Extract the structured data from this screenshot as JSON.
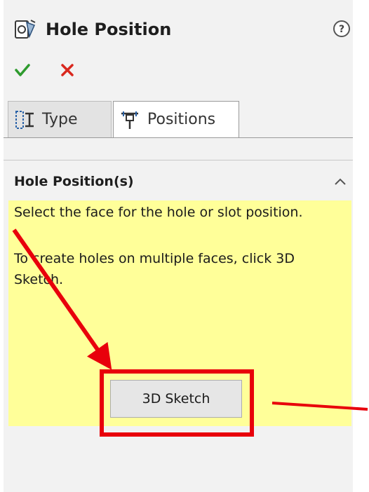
{
  "header": {
    "title": "Hole Position",
    "feature_icon": "hole-wizard-icon",
    "help_icon": "help-icon"
  },
  "actions": {
    "ok_icon": "checkmark-icon",
    "cancel_icon": "x-icon",
    "ok_color": "#2e9b2e",
    "cancel_color": "#d9281e"
  },
  "tabs": [
    {
      "label": "Type",
      "icon": "type-tab-icon",
      "active": false
    },
    {
      "label": "Positions",
      "icon": "positions-tab-icon",
      "active": true
    }
  ],
  "group": {
    "title": "Hole Position(s)",
    "collapse_icon": "chevron-up-icon",
    "message_line1": "Select the face for the hole or slot position.",
    "message_line2": "To create holes on multiple faces, click 3D Sketch.",
    "message_bg": "#ffff99",
    "button_label": "3D Sketch"
  },
  "annotation": {
    "color": "#e8000b"
  }
}
